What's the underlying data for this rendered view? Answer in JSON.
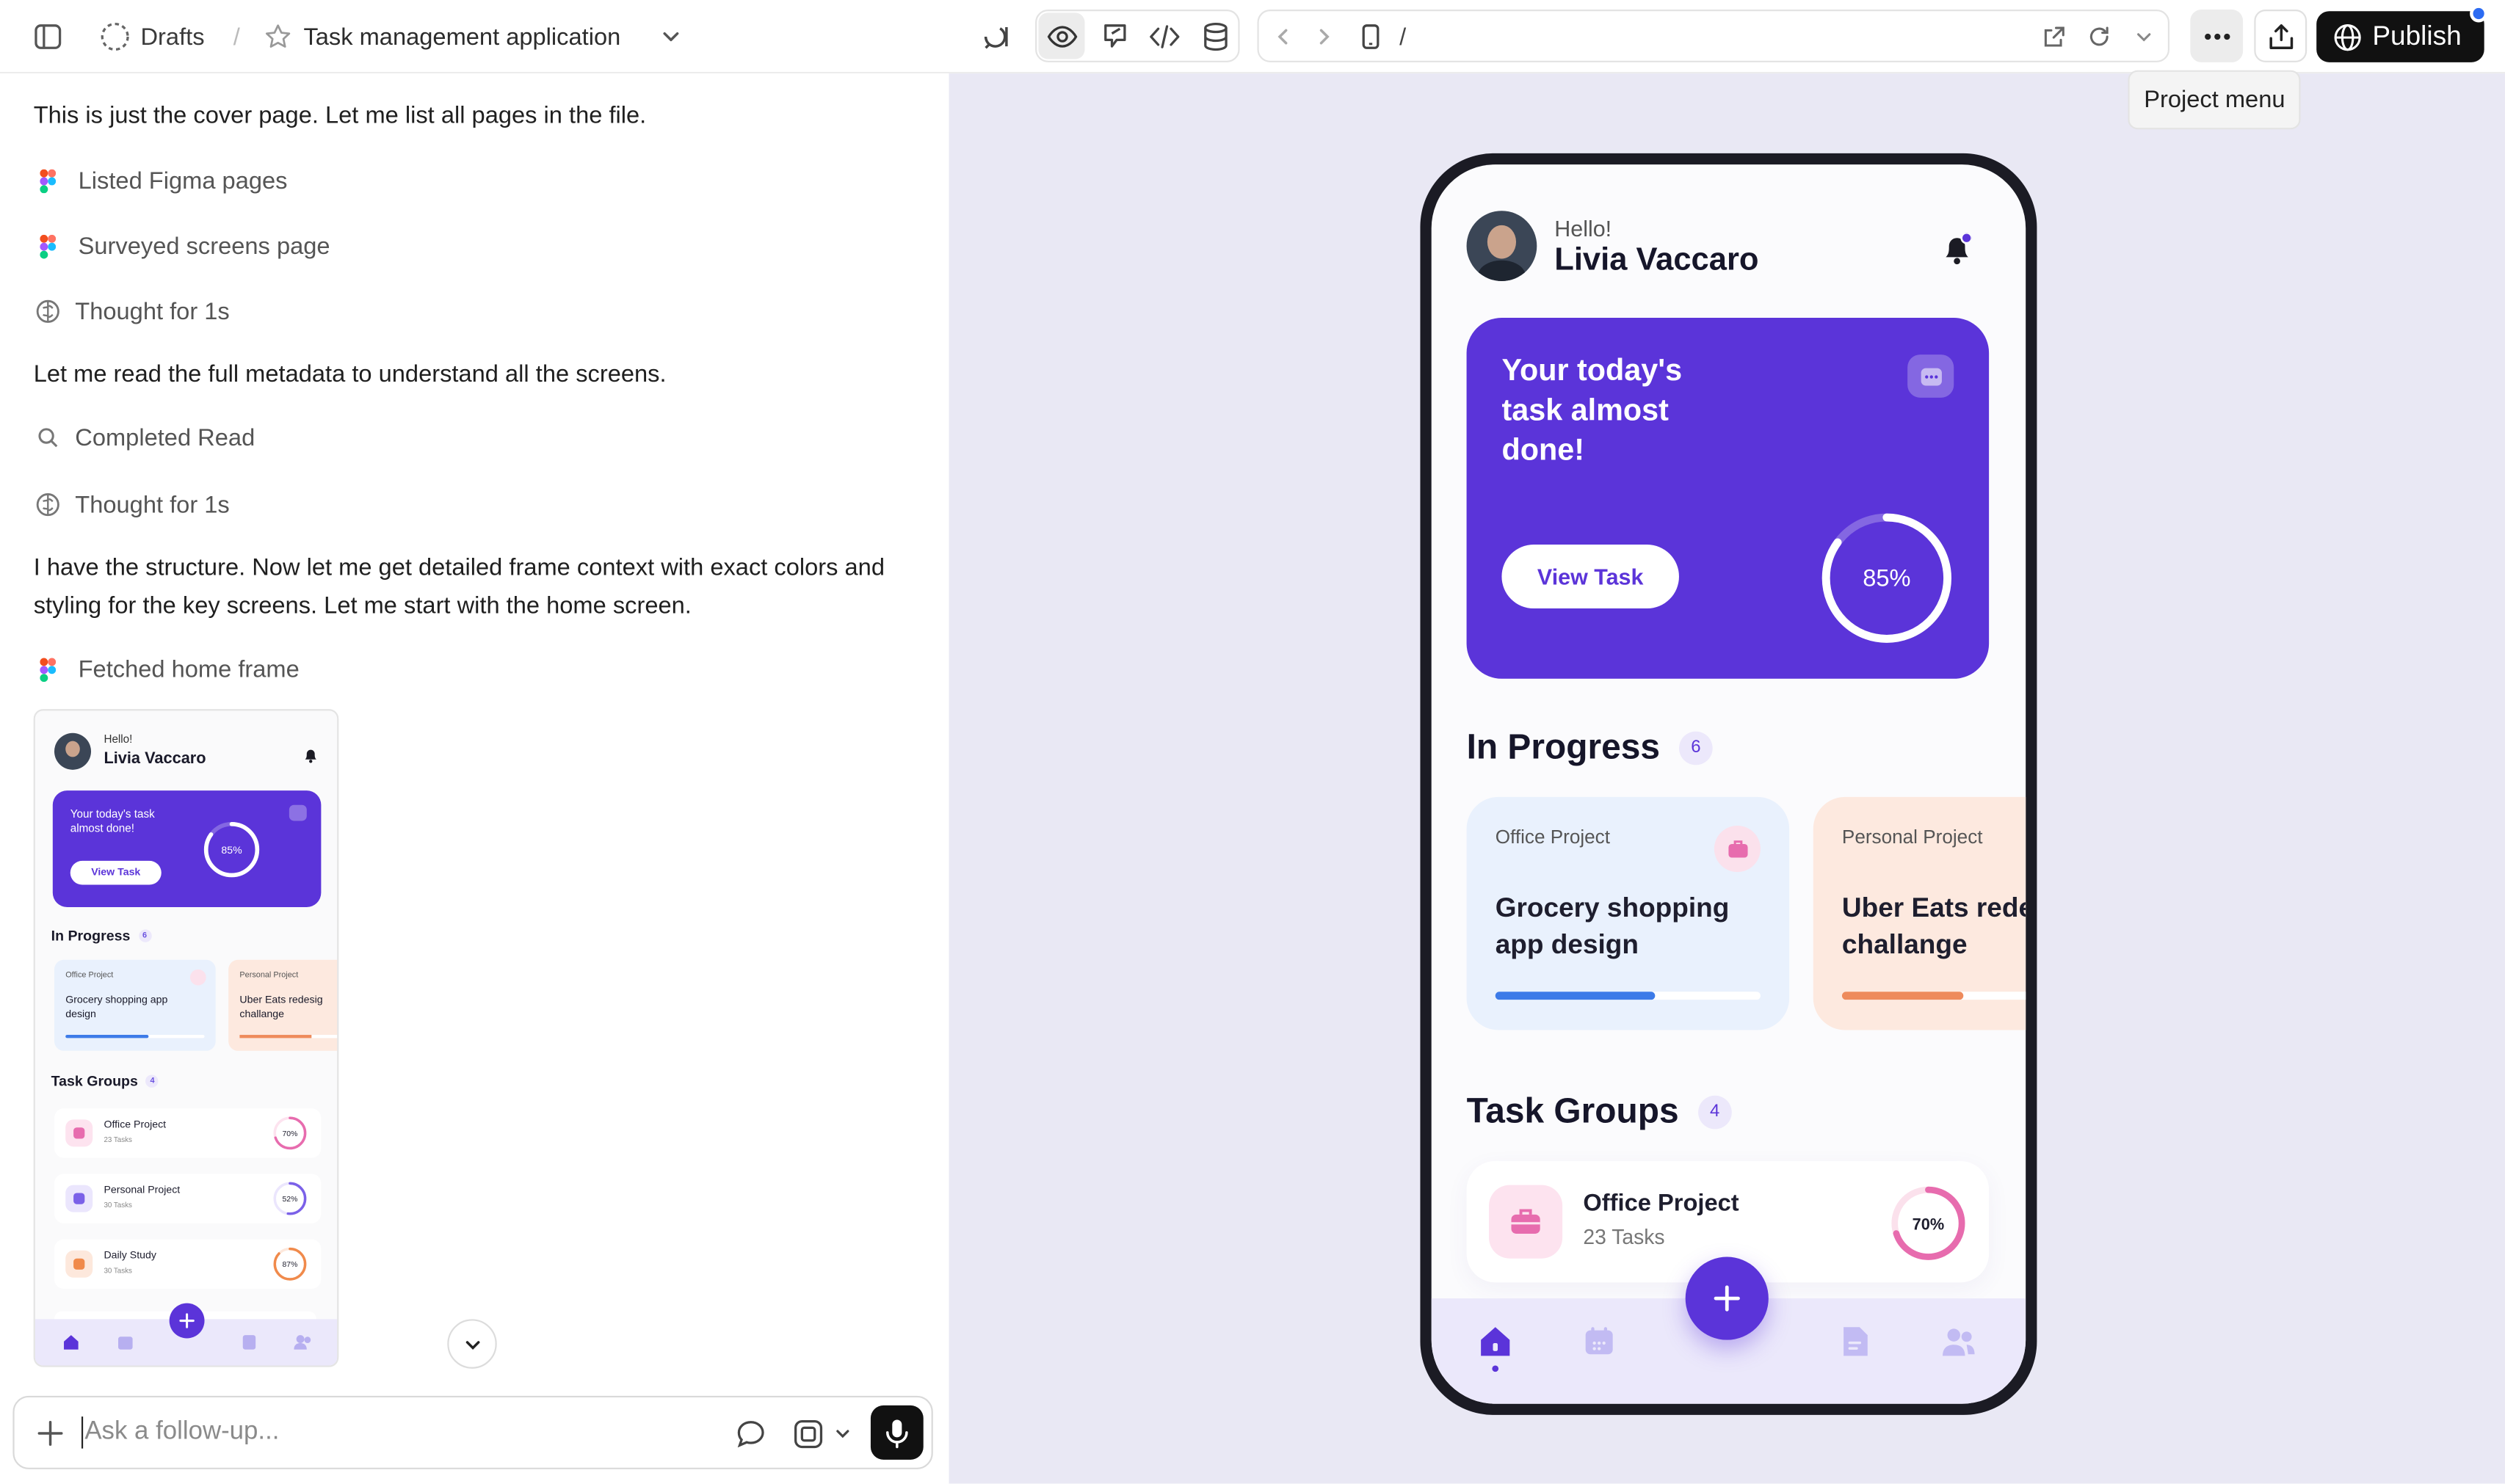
{
  "header": {
    "workspace": "Drafts",
    "separator": "/",
    "project_title": "Task management application",
    "address": "/",
    "publish_label": "Publish",
    "tooltip": "Project menu"
  },
  "chat": {
    "messages": [
      "This is just the cover page. Let me list all pages in the file.",
      "Let me read the full metadata to understand all the screens.",
      "I have the structure. Now let me get detailed frame context with exact colors and styling for the key screens. Let me start with the home screen."
    ],
    "steps": [
      "Listed Figma pages",
      "Surveyed screens page",
      "Thought for 1s",
      "Completed Read",
      "Thought for 1s",
      "Fetched home frame"
    ],
    "composer_placeholder": "Ask a follow-up..."
  },
  "app": {
    "greeting": "Hello!",
    "user_name": "Livia Vaccaro",
    "hero": {
      "title_line1": "Your today's",
      "title_line2": "task almost",
      "title_line3": "done!",
      "title_short1": "Your today's task",
      "title_short2": "almost done!",
      "button": "View Task",
      "progress_label": "85%",
      "progress": 0.85
    },
    "in_progress": {
      "title": "In Progress",
      "count": "6",
      "cards": [
        {
          "category": "Office Project",
          "title_line1": "Grocery shopping",
          "title_line2": "app design",
          "progress": 0.6,
          "color": "#3d7be8",
          "bg": "#e9f1fd"
        },
        {
          "category": "Personal Project",
          "title_line1": "Uber Eats redesign",
          "title_line2": "challange",
          "progress": 0.62,
          "color": "#ee8b5c",
          "bg": "#fde9df"
        }
      ],
      "thumb_cards": [
        {
          "title_line1": "Grocery shopping app",
          "title_line2": "design"
        },
        {
          "title_line1": "Uber Eats redesig",
          "title_line2": "challange"
        }
      ]
    },
    "task_groups": {
      "title": "Task Groups",
      "count": "4",
      "items": [
        {
          "name": "Office Project",
          "tasks": "23 Tasks",
          "percent_label": "70%",
          "percent": 0.7,
          "color": "#e76cae",
          "tint": "#fde3ef"
        },
        {
          "name": "Personal Project",
          "tasks": "30 Tasks",
          "percent_label": "52%",
          "percent": 0.52,
          "color": "#7b61e8",
          "tint": "#ebe6fd"
        },
        {
          "name": "Daily Study",
          "tasks": "30 Tasks",
          "percent_label": "87%",
          "percent": 0.87,
          "color": "#f08a4b",
          "tint": "#fde8dc"
        }
      ]
    },
    "colors": {
      "primary": "#5b34d9",
      "accent_dot": "#5b34d9",
      "publish_bg": "#111111",
      "canvas_bg": "#e9e8f4"
    }
  }
}
